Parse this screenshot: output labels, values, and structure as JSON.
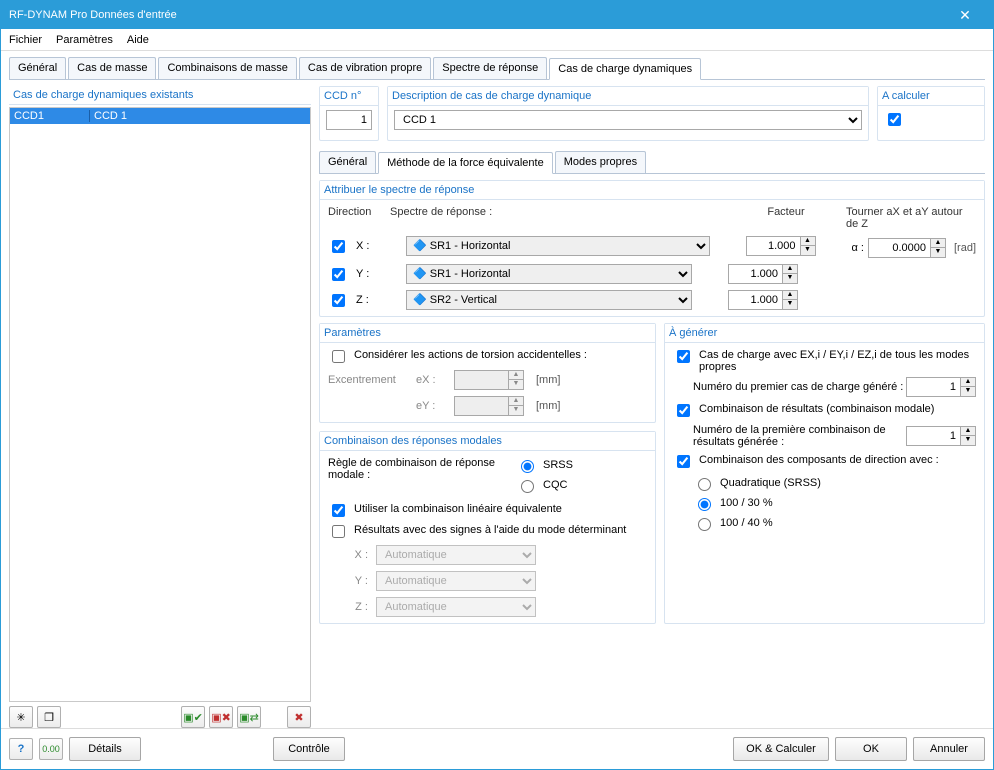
{
  "window_title": "RF-DYNAM Pro Données d'entrée",
  "menu": {
    "file": "Fichier",
    "params": "Paramètres",
    "help": "Aide"
  },
  "outer_tabs": {
    "general": "Général",
    "mass_cases": "Cas de masse",
    "mass_combos": "Combinaisons de masse",
    "eigen": "Cas de vibration propre",
    "spectrum": "Spectre de réponse",
    "dyn_load": "Cas de charge dynamiques"
  },
  "left_panel": {
    "title": "Cas de charge dynamiques existants",
    "row_id": "CCD1",
    "row_name": "CCD 1"
  },
  "top_fields": {
    "ccd_no_label": "CCD n°",
    "ccd_no_value": "1",
    "desc_label": "Description de cas de charge dynamique",
    "desc_value": "CCD 1",
    "calc_label": "A calculer"
  },
  "sub_tabs": {
    "general": "Général",
    "equiv": "Méthode de la force équivalente",
    "modes": "Modes propres"
  },
  "assign": {
    "title": "Attribuer le spectre de réponse",
    "direction": "Direction",
    "spectrum": "Spectre de réponse :",
    "factor": "Facteur",
    "rotate": "Tourner aX et aY autour de Z",
    "alpha": "α :",
    "alpha_value": "0.0000",
    "alpha_unit": "[rad]",
    "rows": {
      "x": {
        "label": "X :",
        "opt": "SR1 - Horizontal",
        "factor": "1.000"
      },
      "y": {
        "label": "Y :",
        "opt": "SR1 - Horizontal",
        "factor": "1.000"
      },
      "z": {
        "label": "Z :",
        "opt": "SR2 - Vertical",
        "factor": "1.000"
      }
    }
  },
  "params": {
    "title": "Paramètres",
    "torsion": "Considérer les actions de torsion accidentelles :",
    "ecc": "Excentrement",
    "ex": "eX :",
    "ey": "eY :",
    "unit": "[mm]"
  },
  "modal": {
    "title": "Combinaison des réponses modales",
    "rule": "Règle de combinaison de réponse modale :",
    "srss": "SRSS",
    "cqc": "CQC",
    "equiv": "Utiliser la combinaison linéaire équivalente",
    "signed": "Résultats avec des signes à l'aide du mode déterminant",
    "x": "X :",
    "y": "Y :",
    "z": "Z :",
    "auto": "Automatique"
  },
  "generate": {
    "title": "À générer",
    "lc_each": "Cas de charge avec EX,i / EY,i  / EZ,i de tous les modes propres",
    "first_lc": "Numéro du premier cas de charge généré :",
    "first_lc_val": "1",
    "res_combo": "Combinaison de résultats (combinaison modale)",
    "first_rc": "Numéro de la première combinaison de résultats générée :",
    "first_rc_val": "1",
    "dir_combo": "Combinaison des composants de direction avec :",
    "quad": "Quadratique (SRSS)",
    "r10030": "100 / 30 %",
    "r10040": "100 / 40 %"
  },
  "footer": {
    "details": "Détails",
    "check": "Contrôle",
    "ok_calc": "OK & Calculer",
    "ok": "OK",
    "cancel": "Annuler"
  }
}
